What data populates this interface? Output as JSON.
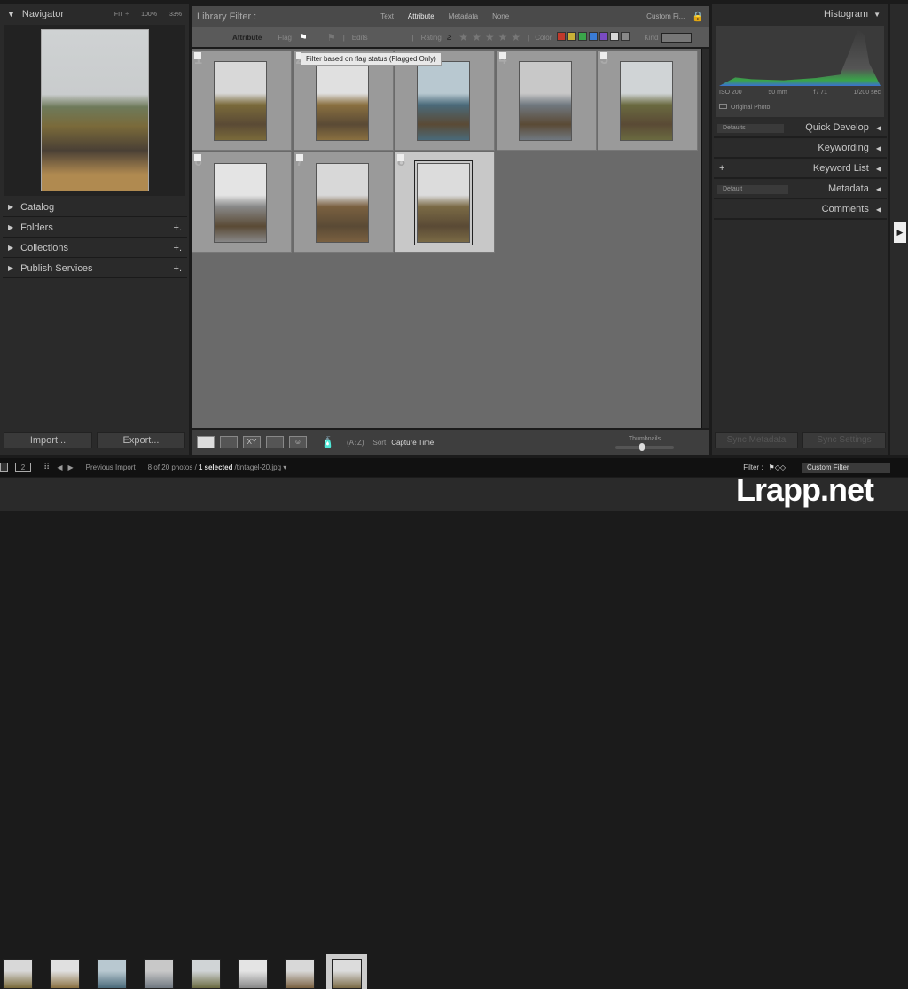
{
  "navigator": {
    "title": "Navigator",
    "fit": "FIT ÷",
    "z100": "100%",
    "z33": "33%"
  },
  "left_sections": [
    {
      "label": "Catalog",
      "plus": ""
    },
    {
      "label": "Folders",
      "plus": "+."
    },
    {
      "label": "Collections",
      "plus": "+."
    },
    {
      "label": "Publish Services",
      "plus": "+."
    }
  ],
  "left_buttons": {
    "import": "Import...",
    "export": "Export..."
  },
  "filter": {
    "title": "Library Filter :",
    "tabs": [
      "Text",
      "Attribute",
      "Metadata",
      "None"
    ],
    "active_tab": "Attribute",
    "preset": "Custom Fi...",
    "attribute_label": "Attribute",
    "flag_label": "Flag",
    "edits_label": "Edits",
    "rating_label": "Rating",
    "rating_op": "≥",
    "color_label": "Color",
    "kind_label": "Kind",
    "colors": [
      "#c0392b",
      "#c9b037",
      "#3aa54a",
      "#3a7bd5",
      "#7a4bc2",
      "#d8d8d8",
      "#888888"
    ],
    "tooltip": "Filter based on flag status (Flagged Only)"
  },
  "grid": {
    "photos": [
      {
        "num": "1",
        "sky": "#d8d8d8",
        "ground": "#7a6a3a"
      },
      {
        "num": "2",
        "sky": "#e0e0e0",
        "ground": "#8a7040"
      },
      {
        "num": "3",
        "sky": "#b8c8d0",
        "ground": "#4a6a7a"
      },
      {
        "num": "4",
        "sky": "#c8c8c8",
        "ground": "#707880"
      },
      {
        "num": "5",
        "sky": "#d0d4d6",
        "ground": "#6a6a40"
      },
      {
        "num": "6",
        "sky": "#e4e4e4",
        "ground": "#888"
      },
      {
        "num": "7",
        "sky": "#d8d8d8",
        "ground": "#7a6040"
      },
      {
        "num": "8",
        "sky": "#dcdcdc",
        "ground": "#7a6a45",
        "selected": true
      }
    ]
  },
  "toolbar": {
    "sort_label": "Sort",
    "sort_value": "Capture Time",
    "thumbnails_label": "Thumbnails",
    "thumbnail_size": 0.45
  },
  "histogram": {
    "title": "Histogram",
    "iso": "ISO 200",
    "focal": "50 mm",
    "aperture": "f / 71",
    "shutter": "1/200 sec",
    "original": "Original Photo"
  },
  "right_sections": [
    {
      "label": "Quick Develop",
      "select": "Defaults"
    },
    {
      "label": "Keywording"
    },
    {
      "label": "Keyword List",
      "plus": "+"
    },
    {
      "label": "Metadata",
      "select": "Default"
    },
    {
      "label": "Comments"
    }
  ],
  "right_buttons": {
    "sync_metadata": "Sync Metadata",
    "sync_settings": "Sync Settings"
  },
  "filmstrip": {
    "source": "Previous Import",
    "count": "8 of 20 photos /",
    "selected": "1 selected",
    "file": "/tintagel-20.jpg ▾",
    "filter_label": "Filter :",
    "filter_value": "Custom Filter",
    "screen2": "2"
  },
  "watermark": "Lrapp.net"
}
